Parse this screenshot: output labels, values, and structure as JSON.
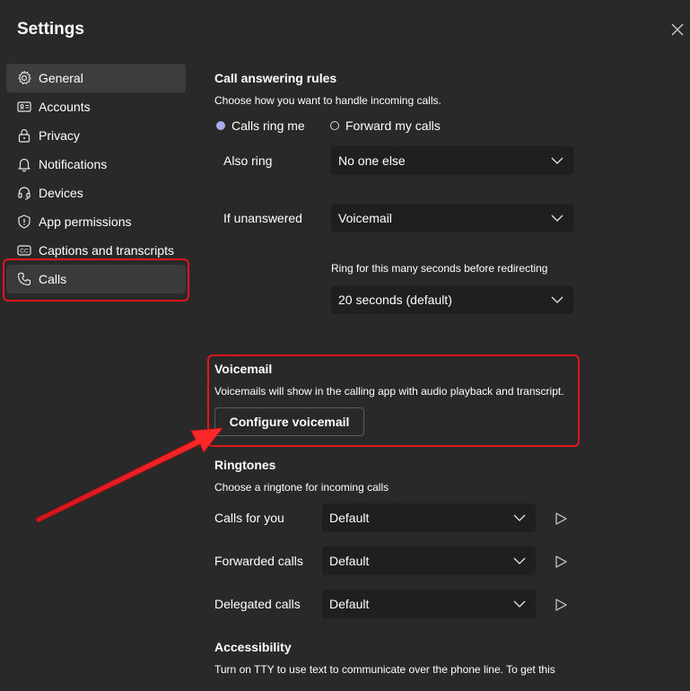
{
  "window": {
    "title": "Settings"
  },
  "sidebar": {
    "items": [
      {
        "label": "General",
        "icon": "gear-icon"
      },
      {
        "label": "Accounts",
        "icon": "id-card-icon"
      },
      {
        "label": "Privacy",
        "icon": "lock-icon"
      },
      {
        "label": "Notifications",
        "icon": "bell-icon"
      },
      {
        "label": "Devices",
        "icon": "headset-icon"
      },
      {
        "label": "App permissions",
        "icon": "shield-icon"
      },
      {
        "label": "Captions and transcripts",
        "icon": "cc-icon"
      },
      {
        "label": "Calls",
        "icon": "phone-icon",
        "selected": true
      }
    ]
  },
  "call_answering": {
    "heading": "Call answering rules",
    "description": "Choose how you want to handle incoming calls.",
    "options": [
      "Calls ring me",
      "Forward my calls"
    ],
    "selected_option": "Calls ring me",
    "also_ring": {
      "label": "Also ring",
      "value": "No one else"
    },
    "if_unanswered": {
      "label": "If unanswered",
      "value": "Voicemail"
    },
    "ring_seconds": {
      "label": "Ring for this many seconds before redirecting",
      "value": "20 seconds (default)"
    }
  },
  "voicemail": {
    "heading": "Voicemail",
    "description": "Voicemails will show in the calling app with audio playback and transcript.",
    "button_label": "Configure voicemail"
  },
  "ringtones": {
    "heading": "Ringtones",
    "description": "Choose a ringtone for incoming calls",
    "rows": [
      {
        "label": "Calls for you",
        "value": "Default"
      },
      {
        "label": "Forwarded calls",
        "value": "Default"
      },
      {
        "label": "Delegated calls",
        "value": "Default"
      }
    ]
  },
  "accessibility": {
    "heading": "Accessibility",
    "description": "Turn on TTY to use text to communicate over the phone line. To get this"
  },
  "colors": {
    "background": "#292929",
    "select_background": "#1f1f1f",
    "accent_radio": "#a9acec",
    "highlight_red": "#e0161e"
  }
}
